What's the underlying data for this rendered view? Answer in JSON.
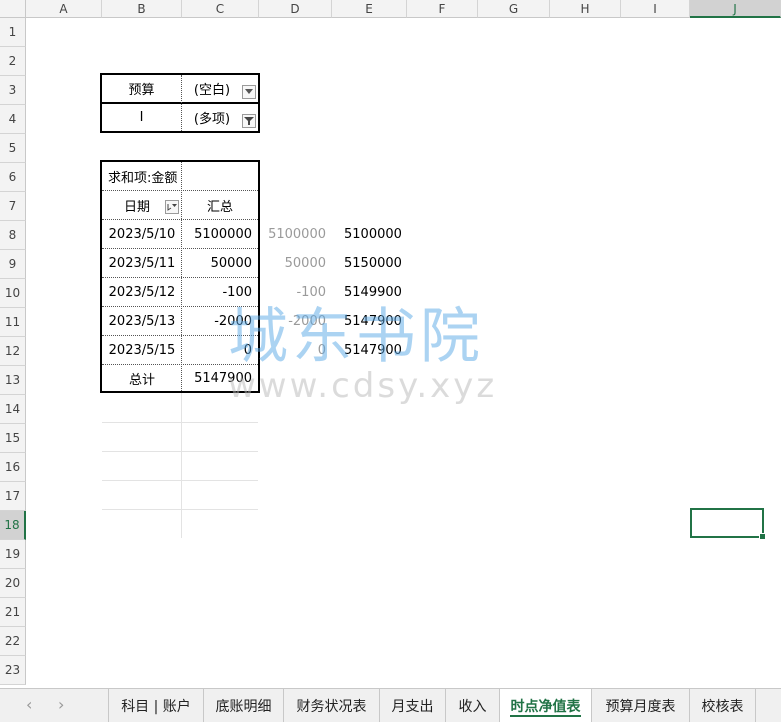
{
  "columns": [
    "A",
    "B",
    "C",
    "D",
    "E",
    "F",
    "G",
    "H",
    "I",
    "J"
  ],
  "selected_column": "J",
  "rows": [
    "1",
    "2",
    "3",
    "4",
    "5",
    "6",
    "7",
    "8",
    "9",
    "10",
    "11",
    "12",
    "13",
    "14",
    "15",
    "16",
    "17",
    "18",
    "19",
    "20",
    "21",
    "22",
    "23"
  ],
  "selected_row": "18",
  "filters": {
    "budget_label": "预算",
    "budget_value": "(空白)",
    "i_label": "I",
    "i_value": "(多项)"
  },
  "pivot": {
    "sum_label": "求和项:金额",
    "date_header": "日期",
    "total_header": "汇总",
    "rows": [
      {
        "date": "2023/5/10",
        "amount": "5100000"
      },
      {
        "date": "2023/5/11",
        "amount": "50000"
      },
      {
        "date": "2023/5/12",
        "amount": "-100"
      },
      {
        "date": "2023/5/13",
        "amount": "-2000"
      },
      {
        "date": "2023/5/15",
        "amount": "0"
      }
    ],
    "grand_total_label": "总计",
    "grand_total": "5147900"
  },
  "side_values": [
    {
      "d": "5100000",
      "e": "5100000"
    },
    {
      "d": "50000",
      "e": "5150000"
    },
    {
      "d": "-100",
      "e": "5149900"
    },
    {
      "d": "-2000",
      "e": "5147900"
    },
    {
      "d": "0",
      "e": "5147900"
    }
  ],
  "watermark": {
    "text_cn": "城东书院",
    "text_en": "www.cdsy.xyz"
  },
  "sheet_tabs": [
    "科目 | 账户",
    "底账明细",
    "财务状况表",
    "月支出",
    "收入",
    "时点净值表",
    "预算月度表",
    "校核表"
  ],
  "active_tab": "时点净值表",
  "nav": {
    "prev": "‹",
    "next": "›"
  }
}
